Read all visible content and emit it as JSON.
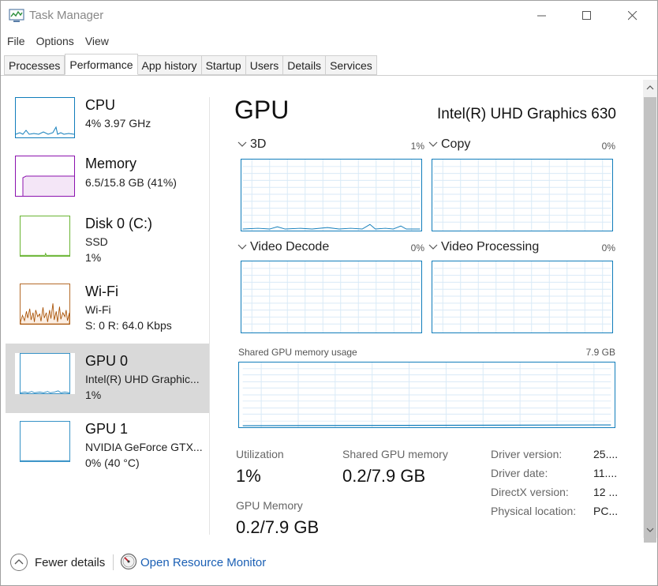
{
  "window": {
    "title": "Task Manager"
  },
  "menu": [
    "File",
    "Options",
    "View"
  ],
  "tabs": [
    "Processes",
    "Performance",
    "App history",
    "Startup",
    "Users",
    "Details",
    "Services"
  ],
  "active_tab": "Performance",
  "sidebar": {
    "items": [
      {
        "title": "CPU",
        "lines": [
          "4%  3.97 GHz"
        ],
        "color": "#117dbb"
      },
      {
        "title": "Memory",
        "lines": [
          "6.5/15.8 GB (41%)"
        ],
        "color": "#8b12ae"
      },
      {
        "title": "Disk 0 (C:)",
        "lines": [
          "SSD",
          "1%"
        ],
        "color": "#4da60c"
      },
      {
        "title": "Wi-Fi",
        "lines": [
          "Wi-Fi",
          "S: 0  R: 64.0 Kbps"
        ],
        "color": "#a74f01"
      },
      {
        "title": "GPU 0",
        "lines": [
          "Intel(R) UHD Graphic...",
          "1%"
        ],
        "color": "#117dbb"
      },
      {
        "title": "GPU 1",
        "lines": [
          "NVIDIA GeForce GTX...",
          "0%  (40 °C)"
        ],
        "color": "#117dbb"
      }
    ]
  },
  "main": {
    "title": "GPU",
    "device": "Intel(R) UHD Graphics 630",
    "engines": [
      {
        "name": "3D",
        "pct": "1%"
      },
      {
        "name": "Copy",
        "pct": "0%"
      },
      {
        "name": "Video Decode",
        "pct": "0%"
      },
      {
        "name": "Video Processing",
        "pct": "0%"
      }
    ],
    "shared_label": "Shared GPU memory usage",
    "shared_max": "7.9 GB",
    "stats": {
      "utilization_label": "Utilization",
      "utilization_value": "1%",
      "shared_label": "Shared GPU memory",
      "shared_value": "0.2/7.9 GB",
      "gpu_mem_label": "GPU Memory",
      "gpu_mem_value": "0.2/7.9 GB"
    },
    "details": [
      {
        "label": "Driver version:",
        "value": "25...."
      },
      {
        "label": "Driver date:",
        "value": "11...."
      },
      {
        "label": "DirectX version:",
        "value": "12 ..."
      },
      {
        "label": "Physical location:",
        "value": "PC..."
      }
    ]
  },
  "footer": {
    "fewer_details": "Fewer details",
    "open_resmon": "Open Resource Monitor"
  },
  "colors": {
    "accent": "#117dbb",
    "link": "#1a5fb4",
    "selected_bg": "#d9d9d9"
  }
}
